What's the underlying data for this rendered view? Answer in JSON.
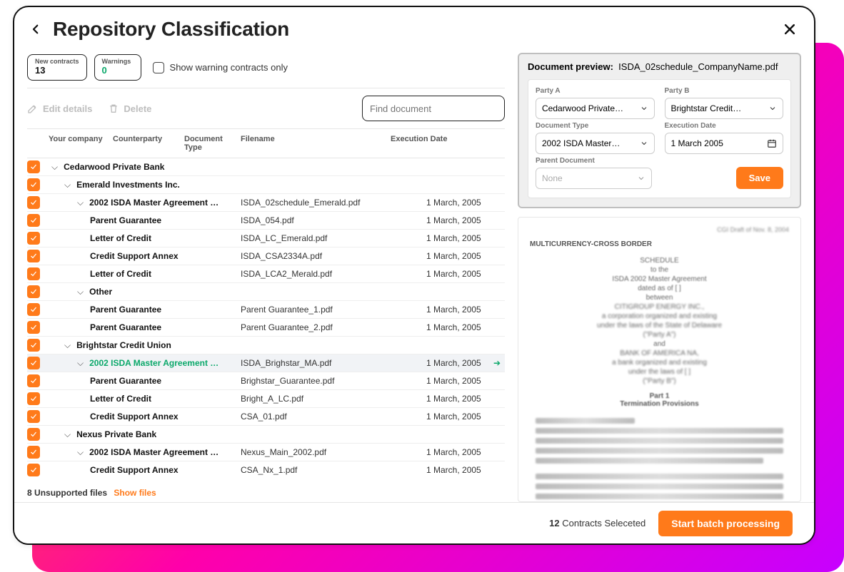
{
  "header": {
    "title": "Repository Classification"
  },
  "chips": {
    "new_label": "New contracts",
    "new_value": "13",
    "warn_label": "Warnings",
    "warn_value": "0",
    "show_only": "Show warning contracts only"
  },
  "toolbar": {
    "edit": "Edit details",
    "delete": "Delete",
    "search_placeholder": "Find document"
  },
  "columns": {
    "your": "Your company",
    "cp": "Counterparty",
    "doc": "Document Type",
    "file": "Filename",
    "exec": "Execution Date"
  },
  "rows": [
    {
      "type": "group",
      "indent": 0,
      "label": "Cedarwood Private Bank"
    },
    {
      "type": "group",
      "indent": 1,
      "label": "Emerald Investments Inc."
    },
    {
      "type": "doc",
      "indent": 2,
      "exp": true,
      "label": "2002 ISDA Master Agreement …",
      "file": "ISDA_02schedule_Emerald.pdf",
      "date": "1 March, 2005"
    },
    {
      "type": "doc",
      "indent": 3,
      "label": "Parent Guarantee",
      "file": "ISDA_054.pdf",
      "date": "1 March, 2005"
    },
    {
      "type": "doc",
      "indent": 3,
      "label": "Letter of Credit",
      "file": "ISDA_LC_Emerald.pdf",
      "date": "1 March, 2005"
    },
    {
      "type": "doc",
      "indent": 3,
      "label": "Credit Support Annex",
      "file": "ISDA_CSA2334A.pdf",
      "date": "1 March, 2005"
    },
    {
      "type": "doc",
      "indent": 3,
      "label": "Letter of Credit",
      "file": "ISDA_LCA2_Merald.pdf",
      "date": "1 March, 2005"
    },
    {
      "type": "group",
      "indent": 2,
      "label": "Other"
    },
    {
      "type": "doc",
      "indent": 3,
      "label": "Parent Guarantee",
      "file": "Parent Guarantee_1.pdf",
      "date": "1 March, 2005"
    },
    {
      "type": "doc",
      "indent": 3,
      "label": "Parent Guarantee",
      "file": "Parent Guarantee_2.pdf",
      "date": "1 March, 2005"
    },
    {
      "type": "group",
      "indent": 1,
      "label": "Brightstar Credit Union"
    },
    {
      "type": "doc",
      "indent": 2,
      "exp": true,
      "selected": true,
      "link": true,
      "label": "2002 ISDA Master Agreement …",
      "file": "ISDA_Brighstar_MA.pdf",
      "date": "1 March, 2005"
    },
    {
      "type": "doc",
      "indent": 3,
      "label": "Parent Guarantee",
      "file": "Brighstar_Guarantee.pdf",
      "date": "1 March, 2005"
    },
    {
      "type": "doc",
      "indent": 3,
      "label": "Letter of Credit",
      "file": "Bright_A_LC.pdf",
      "date": "1 March, 2005"
    },
    {
      "type": "doc",
      "indent": 3,
      "label": "Credit Support Annex",
      "file": "CSA_01.pdf",
      "date": "1 March, 2005"
    },
    {
      "type": "group",
      "indent": 1,
      "label": "Nexus Private Bank"
    },
    {
      "type": "doc",
      "indent": 2,
      "exp": true,
      "label": "2002 ISDA Master Agreement …",
      "file": "Nexus_Main_2002.pdf",
      "date": "1 March, 2005"
    },
    {
      "type": "doc",
      "indent": 3,
      "label": "Credit Support Annex",
      "file": "CSA_Nx_1.pdf",
      "date": "1 March, 2005"
    }
  ],
  "unsupported": {
    "count": "8",
    "label": "Unsupported files",
    "show": "Show files"
  },
  "preview": {
    "title_prefix": "Document preview:",
    "filename": "ISDA_02schedule_CompanyName.pdf",
    "fields": {
      "partyA_label": "Party A",
      "partyA": "Cedarwood Private…",
      "partyB_label": "Party B",
      "partyB": "Brightstar Credit…",
      "docType_label": "Document Type",
      "docType": "2002 ISDA Master…",
      "execDate_label": "Execution Date",
      "execDate": "1 March 2005",
      "parent_label": "Parent Document",
      "parent": "None"
    },
    "save": "Save",
    "doc": {
      "corner": "CGI Draft of Nov. 8, 2004",
      "multi": "MULTICURRENCY-CROSS BORDER",
      "lines": [
        "SCHEDULE",
        "to the",
        "ISDA 2002 Master Agreement",
        "dated as of [        ]",
        "between",
        "CITIGROUP ENERGY INC.,",
        "a corporation organized and existing",
        "under the laws of the State of Delaware",
        "(\"Party A\")",
        "and",
        "BANK OF AMERICA NA,",
        "a bank organized and existing",
        "under the laws of [                ]",
        "(\"Party B\")"
      ],
      "part": "Part 1",
      "part_sub": "Termination Provisions",
      "agree": "In this Agreement:"
    }
  },
  "footer": {
    "count_n": "12",
    "count_label": "Contracts Seleceted",
    "primary": "Start batch processing"
  }
}
